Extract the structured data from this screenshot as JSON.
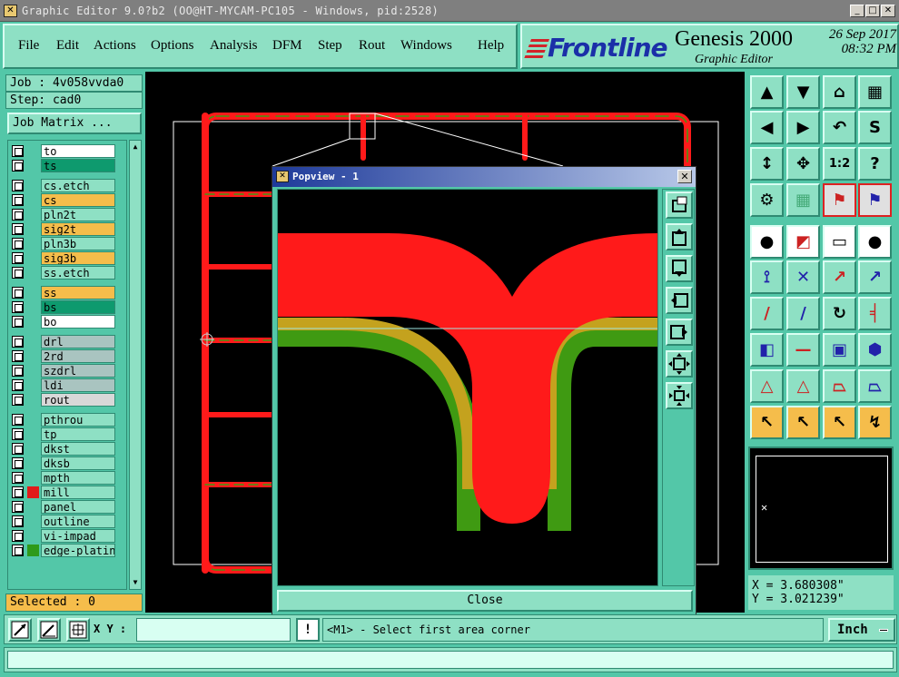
{
  "window": {
    "title": "Graphic Editor 9.0?b2 (OO@HT-MYCAM-PC105 - Windows, pid:2528)",
    "btn_min": "_",
    "btn_max": "□",
    "btn_close": "✕"
  },
  "menu": {
    "file": "File",
    "edit": "Edit",
    "actions": "Actions",
    "options": "Options",
    "analysis": "Analysis",
    "dfm": "DFM",
    "step": "Step",
    "rout": "Rout",
    "windows": "Windows",
    "help": "Help"
  },
  "branding": {
    "logo": "Frontline",
    "product": "Genesis 2000",
    "subtitle": "Graphic Editor",
    "date": "26 Sep 2017",
    "time": "08:32 PM"
  },
  "job": {
    "job_label": "Job : 4v058vvda0",
    "step_label": "Step: cad0",
    "matrix_button": "Job Matrix ...",
    "selected": "Selected : 0"
  },
  "layers": [
    {
      "name": "to",
      "color": "#ffffff",
      "swatch": ""
    },
    {
      "name": "ts",
      "color": "#0e9a6e",
      "swatch": ""
    },
    {
      "name": "cs.etch",
      "color": "#8ee0c4",
      "swatch": ""
    },
    {
      "name": "cs",
      "color": "#f5bd4b",
      "swatch": ""
    },
    {
      "name": "pln2t",
      "color": "#8ee0c4",
      "swatch": ""
    },
    {
      "name": "sig2t",
      "color": "#f5bd4b",
      "swatch": ""
    },
    {
      "name": "pln3b",
      "color": "#8ee0c4",
      "swatch": ""
    },
    {
      "name": "sig3b",
      "color": "#f5bd4b",
      "swatch": ""
    },
    {
      "name": "ss.etch",
      "color": "#8ee0c4",
      "swatch": ""
    },
    {
      "name": "ss",
      "color": "#f5bd4b",
      "swatch": ""
    },
    {
      "name": "bs",
      "color": "#0e9a6e",
      "swatch": ""
    },
    {
      "name": "bo",
      "color": "#ffffff",
      "swatch": ""
    },
    {
      "name": "drl",
      "color": "#a9c4c0",
      "swatch": ""
    },
    {
      "name": "2rd",
      "color": "#a9c4c0",
      "swatch": ""
    },
    {
      "name": "szdrl",
      "color": "#a9c4c0",
      "swatch": ""
    },
    {
      "name": "ldi",
      "color": "#a9c4c0",
      "swatch": ""
    },
    {
      "name": "rout",
      "color": "#d8d8d8",
      "swatch": ""
    },
    {
      "name": "pthrou",
      "color": "#8ee0c4",
      "swatch": ""
    },
    {
      "name": "tp",
      "color": "#8ee0c4",
      "swatch": ""
    },
    {
      "name": "dkst",
      "color": "#8ee0c4",
      "swatch": ""
    },
    {
      "name": "dksb",
      "color": "#8ee0c4",
      "swatch": ""
    },
    {
      "name": "mpth",
      "color": "#8ee0c4",
      "swatch": ""
    },
    {
      "name": "mill",
      "color": "#8ee0c4",
      "swatch": "#e21b1b"
    },
    {
      "name": "panel",
      "color": "#8ee0c4",
      "swatch": ""
    },
    {
      "name": "outline",
      "color": "#8ee0c4",
      "swatch": ""
    },
    {
      "name": "vi-impad",
      "color": "#8ee0c4",
      "swatch": ""
    },
    {
      "name": "edge-plating",
      "color": "#8ee0c4",
      "swatch": "#2e9a1a"
    }
  ],
  "popview": {
    "title": "Popview - 1",
    "close_label": "Close"
  },
  "bottom": {
    "xy_label": "X Y :",
    "xy_value": "",
    "excl": "!",
    "status": "<M1> - Select first area corner",
    "units": "Inch"
  },
  "coords": {
    "x": "X = 3.680308\"",
    "y": "Y = 3.021239\""
  },
  "toolbar_icons": [
    "move-up-icon",
    "move-down-icon",
    "home-icon",
    "grid-frame-icon",
    "move-left-icon",
    "move-right-icon",
    "undo-icon",
    "snap-icon",
    "fit-vertical-icon",
    "fit-all-icon",
    "scale-1-2-icon",
    "help-icon",
    "measure-tool-icon",
    "grid-icon",
    "layers-red-icon",
    "layers-blue-icon",
    "pad-icon",
    "region-icon",
    "ruler-icon",
    "circle-icon",
    "connect-icon",
    "cross-icon",
    "route-icon",
    "arc-icon",
    "line-icon",
    "line-blue-icon",
    "rotate-icon",
    "mirror-icon",
    "pad-add-icon",
    "line-mid-icon",
    "square-icon",
    "polygon-icon",
    "triangle-icon",
    "triangle-cut-icon",
    "trapezoid-icon",
    "trapezoid-line-icon",
    "select-arrow-icon",
    "select-box-icon",
    "select-poly-icon",
    "select-net-icon"
  ],
  "colors": {
    "ui_bg": "#53c7a8",
    "ui_light": "#8ee0c4",
    "copper": "#ff1a1a",
    "soldermask": "#3f9a12",
    "overlap": "#c4a21e",
    "highlight": "#f5bd4b"
  }
}
